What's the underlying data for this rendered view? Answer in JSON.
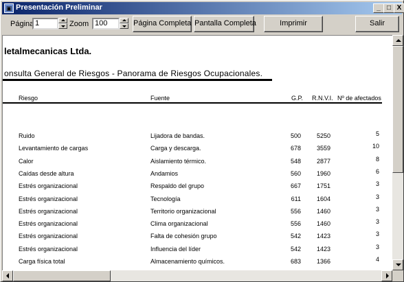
{
  "window": {
    "title": "Presentación Preliminar",
    "controls": [
      "_",
      "□",
      "X"
    ]
  },
  "toolbar": {
    "page_label": "Página",
    "page_value": "1",
    "zoom_label": "Zoom",
    "zoom_value": "100",
    "btn_full_page": "Página Completa",
    "btn_full_screen": "Pantalla Completa",
    "btn_print": "Imprimir",
    "btn_exit": "Salir"
  },
  "report": {
    "company": "letalmecanicas Ltda.",
    "title": "onsulta General de Riesgos - Panorama de Riesgos Ocupacionales.",
    "columns": [
      "Riesgo",
      "Fuente",
      "G.P.",
      "R.N.V.I.",
      "Nº de afectados"
    ],
    "rows": [
      [
        "Ruido",
        "Lijadora de bandas.",
        "500",
        "5250",
        "5"
      ],
      [
        "Levantamiento de cargas",
        "Carga y descarga.",
        "678",
        "3559",
        "10"
      ],
      [
        "Calor",
        "Aislamiento térmico.",
        "548",
        "2877",
        "8"
      ],
      [
        "Caídas desde altura",
        "Andamios",
        "560",
        "1960",
        "6"
      ],
      [
        "Estrés organizacional",
        "Respaldo del grupo",
        "667",
        "1751",
        "3"
      ],
      [
        "Estrés organizacional",
        "Tecnología",
        "611",
        "1604",
        "3"
      ],
      [
        "Estrés organizacional",
        "Territorio organizacional",
        "556",
        "1460",
        "3"
      ],
      [
        "Estrés organizacional",
        "Clima organizacional",
        "556",
        "1460",
        "3"
      ],
      [
        "Estrés organizacional",
        "Falta de cohesión grupo",
        "542",
        "1423",
        "3"
      ],
      [
        "Estrés organizacional",
        "Influencia del líder",
        "542",
        "1423",
        "3"
      ],
      [
        "Carga física total",
        "Almacenamiento químicos.",
        "683",
        "1366",
        "4"
      ]
    ]
  }
}
